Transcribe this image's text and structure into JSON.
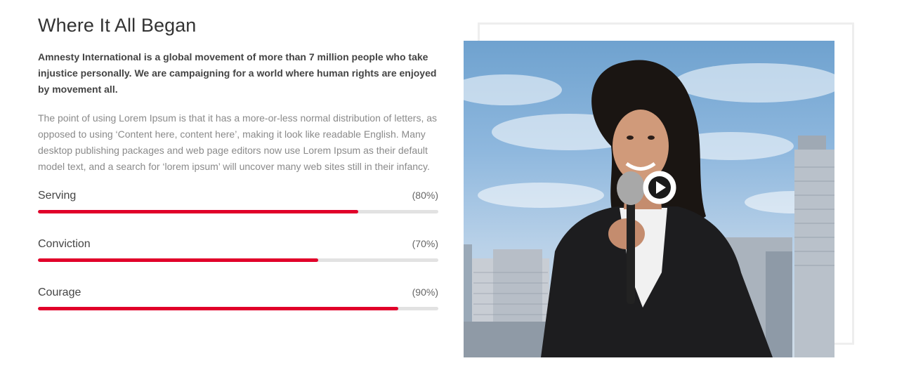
{
  "section": {
    "title": "Where It All Began",
    "lead": "Amnesty International is a global movement of more than 7 million people who take injustice personally. We are campaigning for a world where human rights are enjoyed by movement  all.",
    "body": "The point of using Lorem Ipsum is that it has a more-or-less normal distribution of letters, as opposed to using ‘Content here, content here’, making it look like readable English. Many desktop publishing packages and web page editors now use Lorem Ipsum as their default model text, and a search for ‘lorem ipsum’ will uncover many web sites still in their infancy."
  },
  "skills": [
    {
      "label": "Serving",
      "percent_text": "(80%)",
      "value": 0.8
    },
    {
      "label": "Conviction",
      "percent_text": "(70%)",
      "value": 0.7
    },
    {
      "label": "Courage",
      "percent_text": "(90%)",
      "value": 0.9
    }
  ],
  "colors": {
    "accent": "#e1002a",
    "track": "#e2e2e2"
  },
  "media": {
    "icon": "play-icon"
  }
}
